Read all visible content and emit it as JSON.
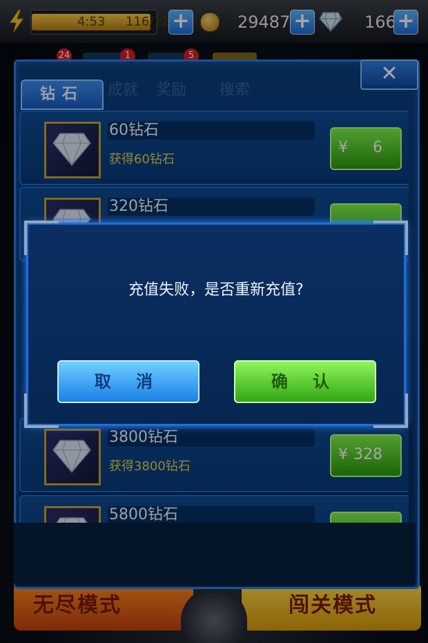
{
  "top_bar": {
    "energy_time": "4:53",
    "energy_count": "116/120",
    "energy_fraction": 0.967,
    "coins": "29487",
    "diamonds": "166",
    "plus_label": "+"
  },
  "background": {
    "badges": [
      "24",
      "1",
      "5"
    ],
    "tab_labels": [
      "成就",
      "奖励",
      "搜索"
    ],
    "mode_left": "无尽模式",
    "mode_right": "闯关模式"
  },
  "shop": {
    "tab_label": "钻石",
    "close_label": "✕",
    "currency_symbol": "¥",
    "items": [
      {
        "name": "60钻石",
        "desc": "获得60钻石",
        "price": "6"
      },
      {
        "name": "320钻石",
        "desc": "",
        "price": ""
      },
      {
        "name": "3800钻石",
        "desc": "获得3800钻石",
        "price": "328"
      },
      {
        "name": "5800钻石",
        "desc": "",
        "price": ""
      }
    ]
  },
  "dialog": {
    "message": "充值失败，是否重新充值?",
    "cancel_label": "取 消",
    "confirm_label": "确 认"
  },
  "colors": {
    "panel_blue": "#0a3e7d",
    "accent_blue": "#2f7de0",
    "buy_green": "#2c9a0e",
    "desc_yellow": "#e4d24a"
  }
}
